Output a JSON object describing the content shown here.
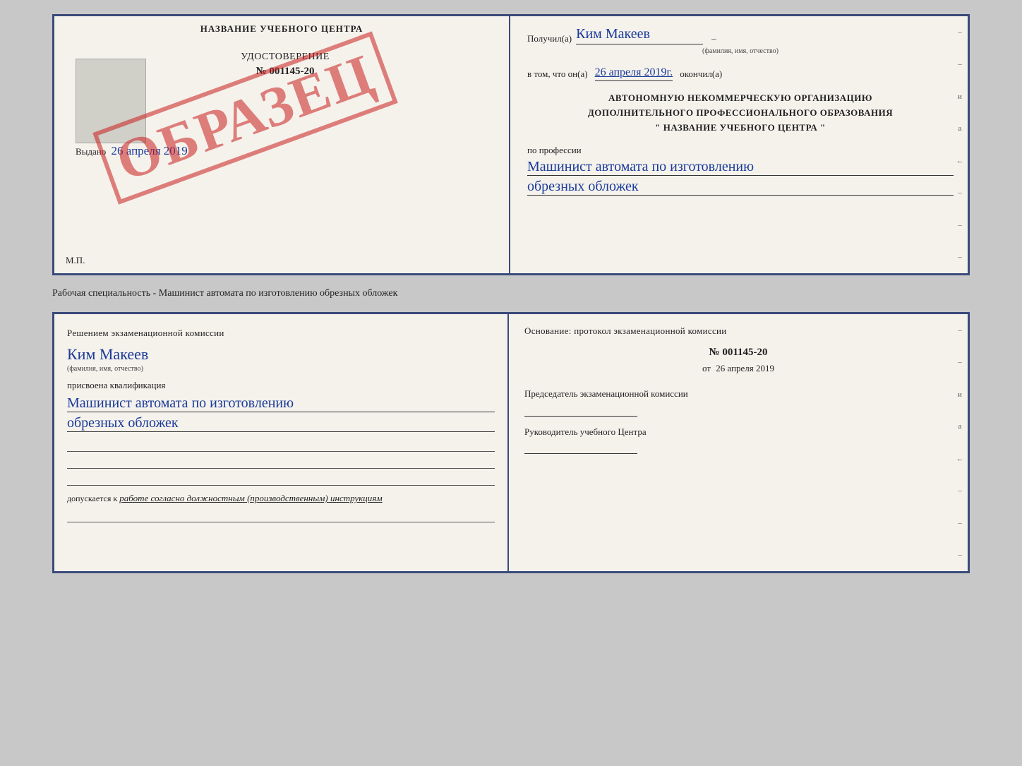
{
  "topLeft": {
    "schoolNameLabel": "НАЗВАНИЕ УЧЕБНОГО ЦЕНТРА",
    "certTitle": "УДОСТОВЕРЕНИЕ",
    "certNumber": "№ 001145-20",
    "issuedLabel": "Выдано",
    "issuedDate": "26 апреля 2019",
    "mpLabel": "М.П.",
    "watermark": "ОБРАЗЕЦ"
  },
  "topRight": {
    "receivedLabel": "Получил(а)",
    "receivedName": "Ким Макеев",
    "fioSub": "(фамилия, имя, отчество)",
    "datePrefix": "в том, что он(а)",
    "date": "26 апреля 2019г.",
    "dateSuffix": "окончил(а)",
    "orgLine1": "АВТОНОМНУЮ НЕКОММЕРЧЕСКУЮ ОРГАНИЗАЦИЮ",
    "orgLine2": "ДОПОЛНИТЕЛЬНОГО ПРОФЕССИОНАЛЬНОГО ОБРАЗОВАНИЯ",
    "orgLine3": "\"  НАЗВАНИЕ УЧЕБНОГО ЦЕНТРА  \"",
    "professionLabel": "по профессии",
    "profession1": "Машинист автомата по изготовлению",
    "profession2": "обрезных обложек",
    "edgeChars": [
      "–",
      "–",
      "и",
      "а",
      "←",
      "–",
      "–",
      "–"
    ]
  },
  "specialtyLabel": "Рабочая специальность - Машинист автомата по изготовлению обрезных обложек",
  "bottomLeft": {
    "commissionLine1": "Решением экзаменационной комиссии",
    "personName": "Ким Макеев",
    "fioSub": "(фамилия, имя, отчество)",
    "qualLabel": "присвоена квалификация",
    "qual1": "Машинист автомата по изготовлению",
    "qual2": "обрезных обложек",
    "allowedLabel": "допускается к",
    "allowedText": "работе согласно должностным (производственным) инструкциям"
  },
  "bottomRight": {
    "basisLabel": "Основание: протокол экзаменационной комиссии",
    "protocolNumber": "№  001145-20",
    "protocolDatePrefix": "от",
    "protocolDate": "26 апреля 2019",
    "chairmanTitle": "Председатель экзаменационной комиссии",
    "headTitle": "Руководитель учебного Центра",
    "edgeChars": [
      "–",
      "–",
      "и",
      "а",
      "←",
      "–",
      "–",
      "–"
    ]
  }
}
